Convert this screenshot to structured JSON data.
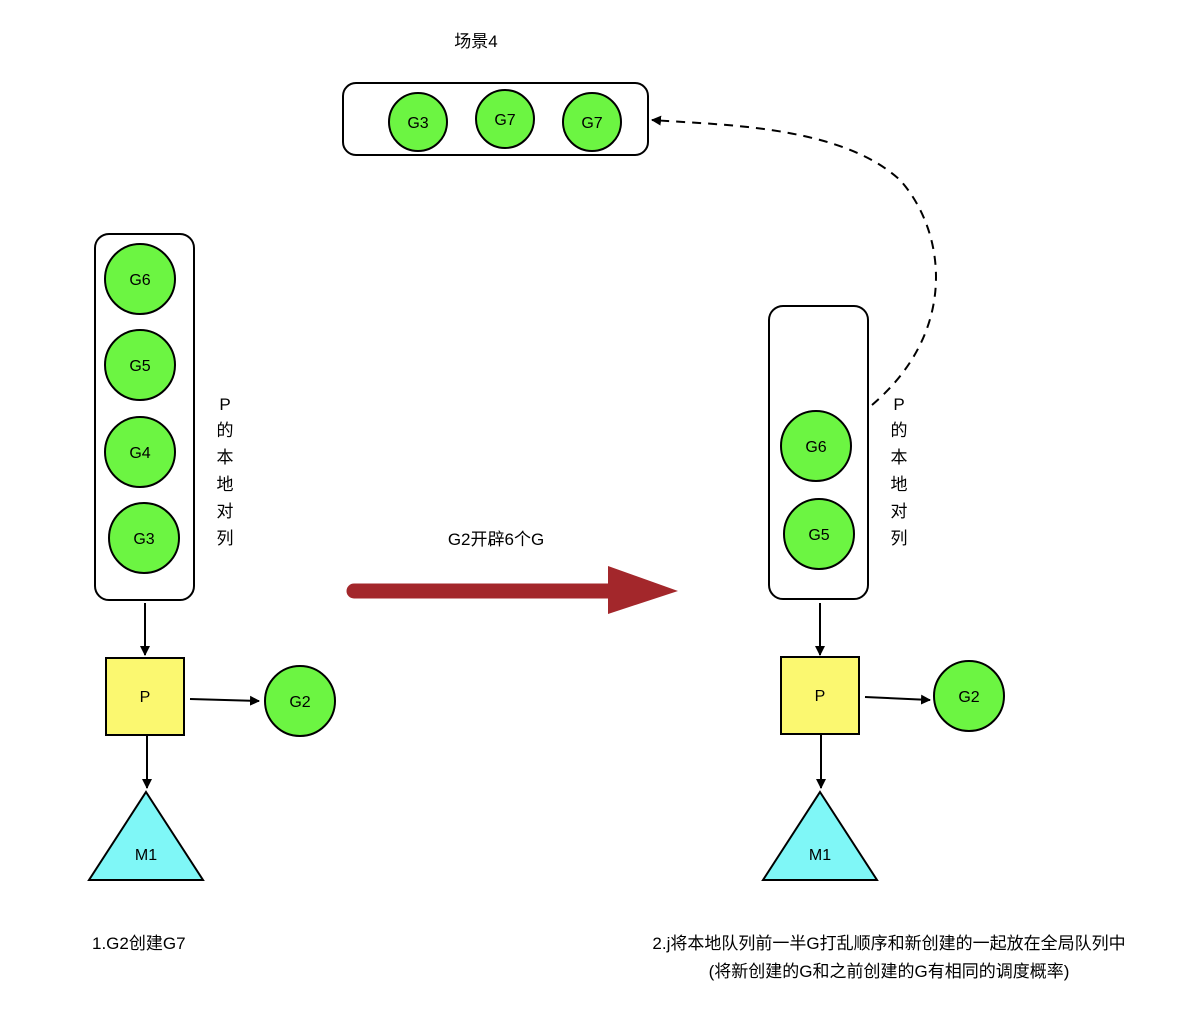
{
  "scene_title": "场景4",
  "global_queue": {
    "items": [
      "G3",
      "G7",
      "G7"
    ]
  },
  "left": {
    "local_queue": [
      "G6",
      "G5",
      "G4",
      "G3"
    ],
    "queue_label": [
      "P",
      "的",
      "本",
      "地",
      "对",
      "列"
    ],
    "processor": "P",
    "running_g": "G2",
    "machine": "M1",
    "caption": "1.G2创建G7"
  },
  "transition": {
    "label": "G2开辟6个G"
  },
  "right": {
    "local_queue": [
      "G6",
      "G5"
    ],
    "queue_label": [
      "P",
      "的",
      "本",
      "地",
      "对",
      "列"
    ],
    "processor": "P",
    "running_g": "G2",
    "machine": "M1",
    "caption_line1": "2.j将本地队列前一半G打乱顺序和新创建的一起放在全局队列中",
    "caption_line2": "(将新创建的G和之前创建的G有相同的调度概率)"
  },
  "colors": {
    "goroutine": "#6cf542",
    "processor": "#fbf870",
    "machine": "#7ff7f7",
    "big_arrow": "#a3272b",
    "stroke": "#000000"
  }
}
